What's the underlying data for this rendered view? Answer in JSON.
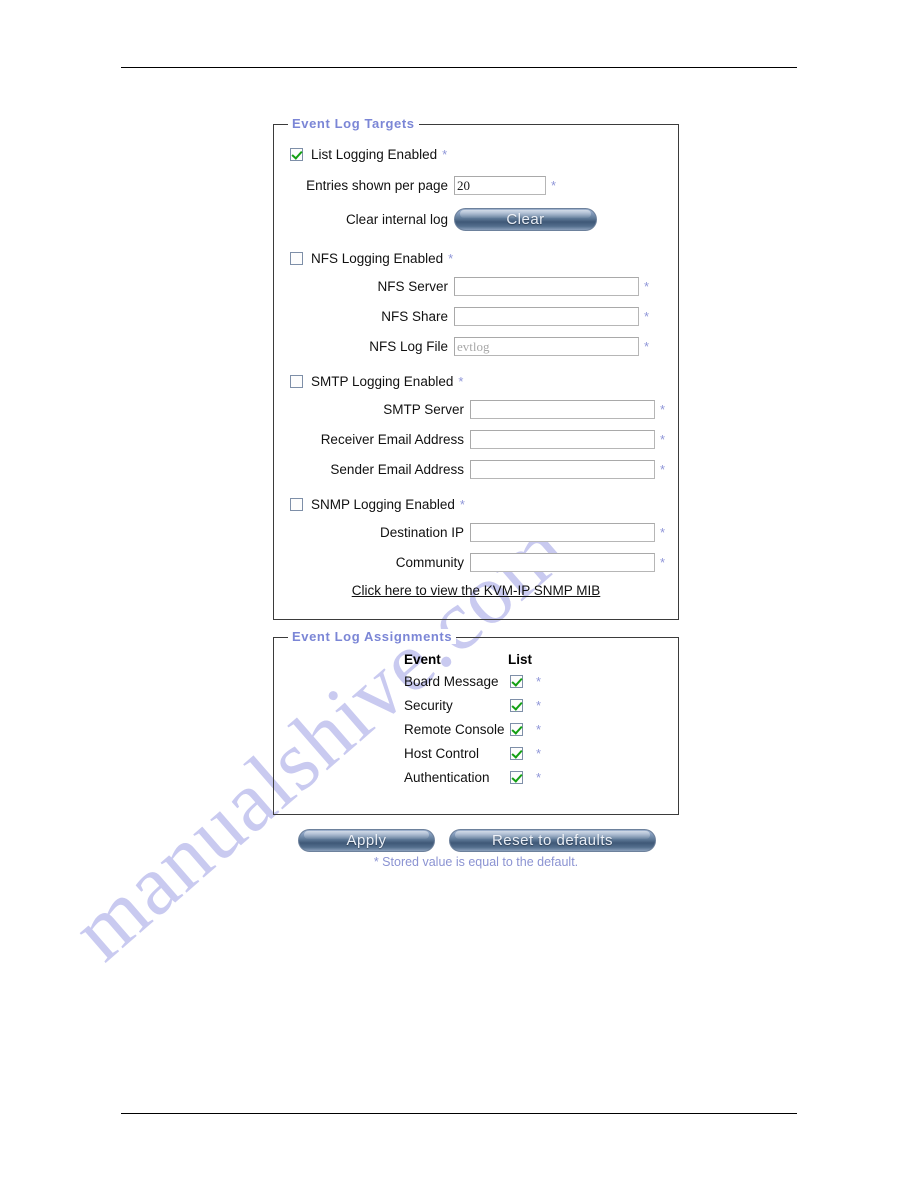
{
  "watermark": {
    "text": "manualshive.com"
  },
  "targets": {
    "legend": "Event Log Targets",
    "list": {
      "checkbox_label": "List Logging Enabled",
      "checked": true,
      "star": "*",
      "entries_label": "Entries shown per page",
      "entries_value": "20",
      "entries_star": "*",
      "clear_label": "Clear internal log",
      "clear_button": "Clear"
    },
    "nfs": {
      "checkbox_label": "NFS Logging Enabled",
      "checked": false,
      "star": "*",
      "server_label": "NFS Server",
      "server_value": "",
      "server_star": "*",
      "share_label": "NFS Share",
      "share_value": "",
      "share_star": "*",
      "logfile_label": "NFS Log File",
      "logfile_value": "evtlog",
      "logfile_star": "*"
    },
    "smtp": {
      "checkbox_label": "SMTP Logging Enabled",
      "checked": false,
      "star": "*",
      "server_label": "SMTP Server",
      "server_value": "",
      "server_star": "*",
      "receiver_label": "Receiver Email Address",
      "receiver_value": "",
      "receiver_star": "*",
      "sender_label": "Sender Email Address",
      "sender_value": "",
      "sender_star": "*"
    },
    "snmp": {
      "checkbox_label": "SNMP Logging Enabled",
      "checked": false,
      "star": "*",
      "dest_label": "Destination IP",
      "dest_value": "",
      "dest_star": "*",
      "community_label": "Community",
      "community_value": "",
      "community_star": "*",
      "mib_link": "Click here to view the KVM-IP SNMP MIB"
    }
  },
  "assignments": {
    "legend": "Event Log Assignments",
    "columns": [
      "Event",
      "List"
    ],
    "rows": [
      {
        "event": "Board Message",
        "list_checked": true,
        "star": "*"
      },
      {
        "event": "Security",
        "list_checked": true,
        "star": "*"
      },
      {
        "event": "Remote Console",
        "list_checked": true,
        "star": "*"
      },
      {
        "event": "Host Control",
        "list_checked": true,
        "star": "*"
      },
      {
        "event": "Authentication",
        "list_checked": true,
        "star": "*"
      }
    ]
  },
  "actions": {
    "apply": "Apply",
    "reset": "Reset to defaults",
    "footnote": "* Stored value is equal to the default."
  },
  "colors": {
    "legend_blue": "#7b86d6",
    "star_blue": "#8f96d8",
    "check_green": "#13a013",
    "button_blue": "#3f5877",
    "watermark": "#c9caf0"
  }
}
